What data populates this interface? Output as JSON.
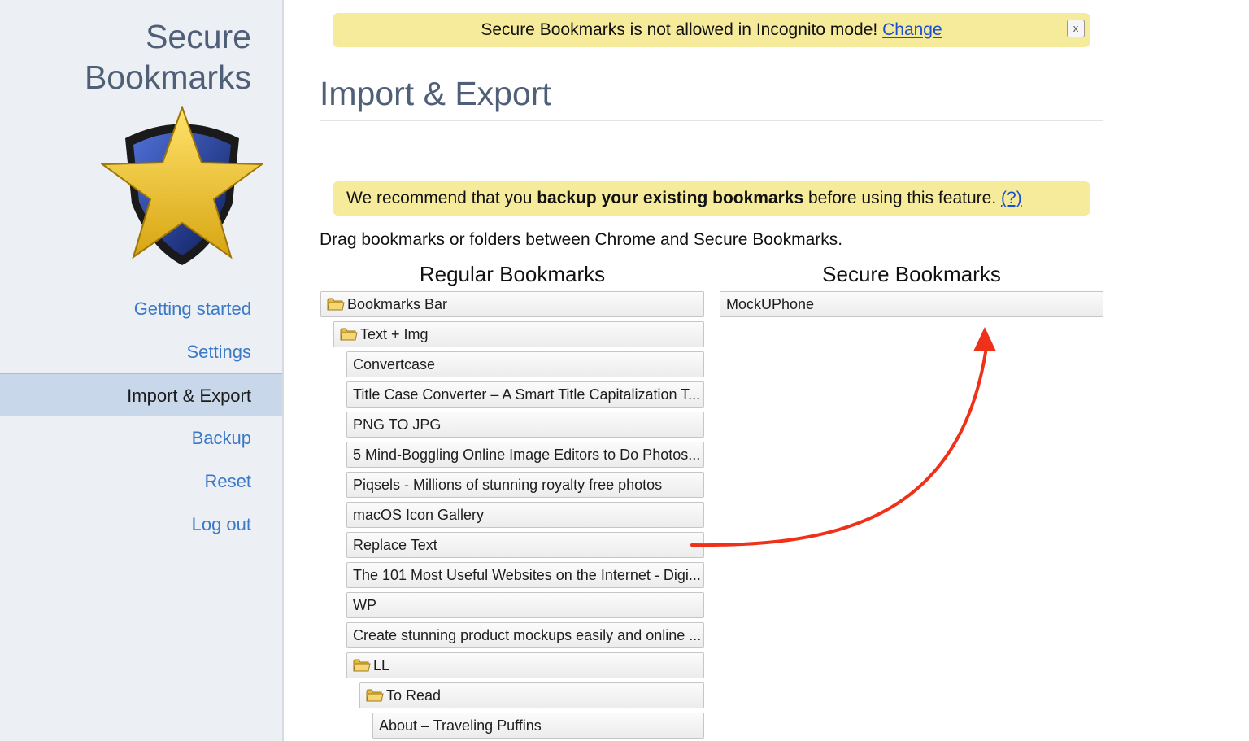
{
  "sidebar": {
    "title_line1": "Secure",
    "title_line2": "Bookmarks",
    "nav": [
      {
        "label": "Getting started",
        "active": false
      },
      {
        "label": "Settings",
        "active": false
      },
      {
        "label": "Import & Export",
        "active": true
      },
      {
        "label": "Backup",
        "active": false
      },
      {
        "label": "Reset",
        "active": false
      },
      {
        "label": "Log out",
        "active": false
      }
    ]
  },
  "top_notice": {
    "text": "Secure Bookmarks is not allowed in Incognito mode! ",
    "link": "Change",
    "close_label": "x"
  },
  "page": {
    "title": "Import & Export",
    "recommend_pre": "We recommend that you ",
    "recommend_bold": "backup your existing bookmarks",
    "recommend_post": " before using this feature. ",
    "recommend_link": "(?)",
    "instruction": "Drag bookmarks or folders between Chrome and Secure Bookmarks."
  },
  "regular": {
    "heading": "Regular Bookmarks",
    "items": [
      {
        "label": "Bookmarks Bar",
        "folder": true,
        "depth": 0
      },
      {
        "label": "Text + Img",
        "folder": true,
        "depth": 1
      },
      {
        "label": "Convertcase",
        "folder": false,
        "depth": 2
      },
      {
        "label": "Title Case Converter – A Smart Title Capitalization T...",
        "folder": false,
        "depth": 2
      },
      {
        "label": "PNG TO JPG",
        "folder": false,
        "depth": 2
      },
      {
        "label": "5 Mind-Boggling Online Image Editors to Do Photos...",
        "folder": false,
        "depth": 2
      },
      {
        "label": "Piqsels - Millions of stunning royalty free photos",
        "folder": false,
        "depth": 2
      },
      {
        "label": "macOS Icon Gallery",
        "folder": false,
        "depth": 2
      },
      {
        "label": "Replace Text",
        "folder": false,
        "depth": 2
      },
      {
        "label": "The 101 Most Useful Websites on the Internet - Digi...",
        "folder": false,
        "depth": 2
      },
      {
        "label": "WP",
        "folder": false,
        "depth": 2
      },
      {
        "label": "Create stunning product mockups easily and online ...",
        "folder": false,
        "depth": 2
      },
      {
        "label": "LL",
        "folder": true,
        "depth": 2
      },
      {
        "label": "To Read",
        "folder": true,
        "depth": 3
      },
      {
        "label": "About – Traveling Puffins",
        "folder": false,
        "depth": 4
      }
    ]
  },
  "secure": {
    "heading": "Secure Bookmarks",
    "items": [
      {
        "label": "MockUPhone",
        "folder": false
      }
    ]
  },
  "colors": {
    "notice_bg": "#f6eb9a",
    "link": "#1a4fd4",
    "nav_link": "#3a79c8",
    "active_nav_bg": "#c8d7ea",
    "arrow": "#f0311a"
  }
}
